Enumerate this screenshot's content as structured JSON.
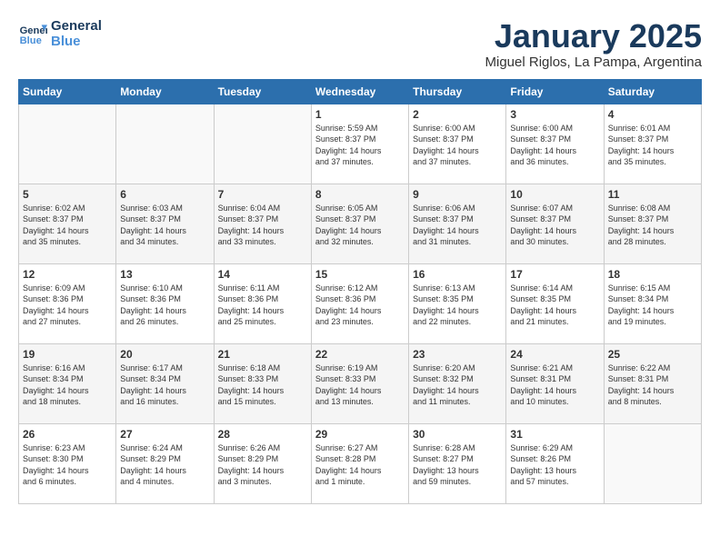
{
  "logo": {
    "line1": "General",
    "line2": "Blue"
  },
  "title": "January 2025",
  "location": "Miguel Riglos, La Pampa, Argentina",
  "weekdays": [
    "Sunday",
    "Monday",
    "Tuesday",
    "Wednesday",
    "Thursday",
    "Friday",
    "Saturday"
  ],
  "weeks": [
    [
      {
        "day": "",
        "info": ""
      },
      {
        "day": "",
        "info": ""
      },
      {
        "day": "",
        "info": ""
      },
      {
        "day": "1",
        "info": "Sunrise: 5:59 AM\nSunset: 8:37 PM\nDaylight: 14 hours\nand 37 minutes."
      },
      {
        "day": "2",
        "info": "Sunrise: 6:00 AM\nSunset: 8:37 PM\nDaylight: 14 hours\nand 37 minutes."
      },
      {
        "day": "3",
        "info": "Sunrise: 6:00 AM\nSunset: 8:37 PM\nDaylight: 14 hours\nand 36 minutes."
      },
      {
        "day": "4",
        "info": "Sunrise: 6:01 AM\nSunset: 8:37 PM\nDaylight: 14 hours\nand 35 minutes."
      }
    ],
    [
      {
        "day": "5",
        "info": "Sunrise: 6:02 AM\nSunset: 8:37 PM\nDaylight: 14 hours\nand 35 minutes."
      },
      {
        "day": "6",
        "info": "Sunrise: 6:03 AM\nSunset: 8:37 PM\nDaylight: 14 hours\nand 34 minutes."
      },
      {
        "day": "7",
        "info": "Sunrise: 6:04 AM\nSunset: 8:37 PM\nDaylight: 14 hours\nand 33 minutes."
      },
      {
        "day": "8",
        "info": "Sunrise: 6:05 AM\nSunset: 8:37 PM\nDaylight: 14 hours\nand 32 minutes."
      },
      {
        "day": "9",
        "info": "Sunrise: 6:06 AM\nSunset: 8:37 PM\nDaylight: 14 hours\nand 31 minutes."
      },
      {
        "day": "10",
        "info": "Sunrise: 6:07 AM\nSunset: 8:37 PM\nDaylight: 14 hours\nand 30 minutes."
      },
      {
        "day": "11",
        "info": "Sunrise: 6:08 AM\nSunset: 8:37 PM\nDaylight: 14 hours\nand 28 minutes."
      }
    ],
    [
      {
        "day": "12",
        "info": "Sunrise: 6:09 AM\nSunset: 8:36 PM\nDaylight: 14 hours\nand 27 minutes."
      },
      {
        "day": "13",
        "info": "Sunrise: 6:10 AM\nSunset: 8:36 PM\nDaylight: 14 hours\nand 26 minutes."
      },
      {
        "day": "14",
        "info": "Sunrise: 6:11 AM\nSunset: 8:36 PM\nDaylight: 14 hours\nand 25 minutes."
      },
      {
        "day": "15",
        "info": "Sunrise: 6:12 AM\nSunset: 8:36 PM\nDaylight: 14 hours\nand 23 minutes."
      },
      {
        "day": "16",
        "info": "Sunrise: 6:13 AM\nSunset: 8:35 PM\nDaylight: 14 hours\nand 22 minutes."
      },
      {
        "day": "17",
        "info": "Sunrise: 6:14 AM\nSunset: 8:35 PM\nDaylight: 14 hours\nand 21 minutes."
      },
      {
        "day": "18",
        "info": "Sunrise: 6:15 AM\nSunset: 8:34 PM\nDaylight: 14 hours\nand 19 minutes."
      }
    ],
    [
      {
        "day": "19",
        "info": "Sunrise: 6:16 AM\nSunset: 8:34 PM\nDaylight: 14 hours\nand 18 minutes."
      },
      {
        "day": "20",
        "info": "Sunrise: 6:17 AM\nSunset: 8:34 PM\nDaylight: 14 hours\nand 16 minutes."
      },
      {
        "day": "21",
        "info": "Sunrise: 6:18 AM\nSunset: 8:33 PM\nDaylight: 14 hours\nand 15 minutes."
      },
      {
        "day": "22",
        "info": "Sunrise: 6:19 AM\nSunset: 8:33 PM\nDaylight: 14 hours\nand 13 minutes."
      },
      {
        "day": "23",
        "info": "Sunrise: 6:20 AM\nSunset: 8:32 PM\nDaylight: 14 hours\nand 11 minutes."
      },
      {
        "day": "24",
        "info": "Sunrise: 6:21 AM\nSunset: 8:31 PM\nDaylight: 14 hours\nand 10 minutes."
      },
      {
        "day": "25",
        "info": "Sunrise: 6:22 AM\nSunset: 8:31 PM\nDaylight: 14 hours\nand 8 minutes."
      }
    ],
    [
      {
        "day": "26",
        "info": "Sunrise: 6:23 AM\nSunset: 8:30 PM\nDaylight: 14 hours\nand 6 minutes."
      },
      {
        "day": "27",
        "info": "Sunrise: 6:24 AM\nSunset: 8:29 PM\nDaylight: 14 hours\nand 4 minutes."
      },
      {
        "day": "28",
        "info": "Sunrise: 6:26 AM\nSunset: 8:29 PM\nDaylight: 14 hours\nand 3 minutes."
      },
      {
        "day": "29",
        "info": "Sunrise: 6:27 AM\nSunset: 8:28 PM\nDaylight: 14 hours\nand 1 minute."
      },
      {
        "day": "30",
        "info": "Sunrise: 6:28 AM\nSunset: 8:27 PM\nDaylight: 13 hours\nand 59 minutes."
      },
      {
        "day": "31",
        "info": "Sunrise: 6:29 AM\nSunset: 8:26 PM\nDaylight: 13 hours\nand 57 minutes."
      },
      {
        "day": "",
        "info": ""
      }
    ]
  ]
}
